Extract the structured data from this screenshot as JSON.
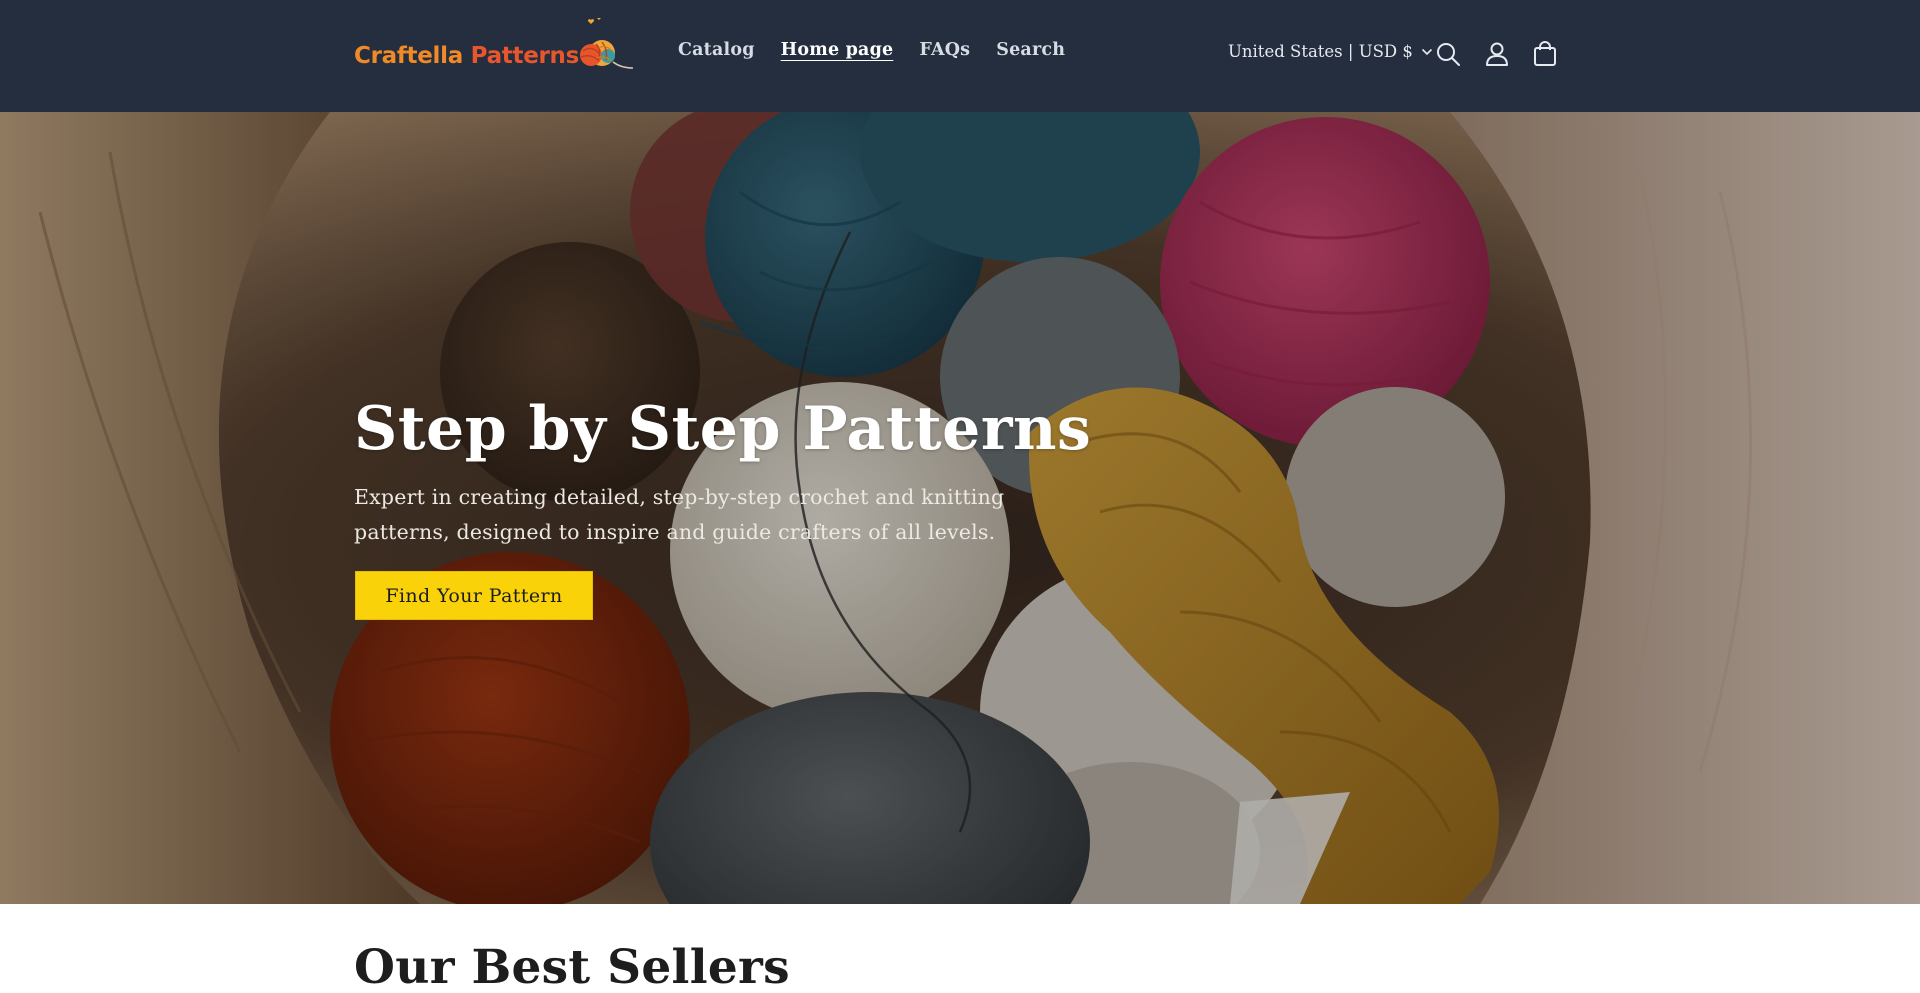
{
  "header": {
    "logo": {
      "text_part1": "Craftella ",
      "text_part2": "Patterns",
      "icon": "yarn-ball-logo-icon"
    },
    "nav": [
      {
        "label": "Catalog",
        "active": false
      },
      {
        "label": "Home page",
        "active": true
      },
      {
        "label": "FAQs",
        "active": false
      },
      {
        "label": "Search",
        "active": false
      }
    ],
    "country_selector": {
      "label": "United States | USD $",
      "icon": "chevron-down-icon"
    },
    "icons": [
      "search-icon",
      "account-icon",
      "cart-icon"
    ]
  },
  "hero": {
    "title": "Step by Step Patterns",
    "subtitle": "Expert in creating detailed, step-by-step crochet and knitting patterns, designed to inspire and guide crafters of all levels.",
    "button_label": "Find Your Pattern",
    "image": "yarn-basket-photo"
  },
  "sections": {
    "best_sellers_title": "Our Best Sellers"
  },
  "colors": {
    "header_bg": "#242e3f",
    "button_bg": "#fad20a",
    "logo_orange": "#f08a26",
    "logo_red": "#e9562d"
  }
}
